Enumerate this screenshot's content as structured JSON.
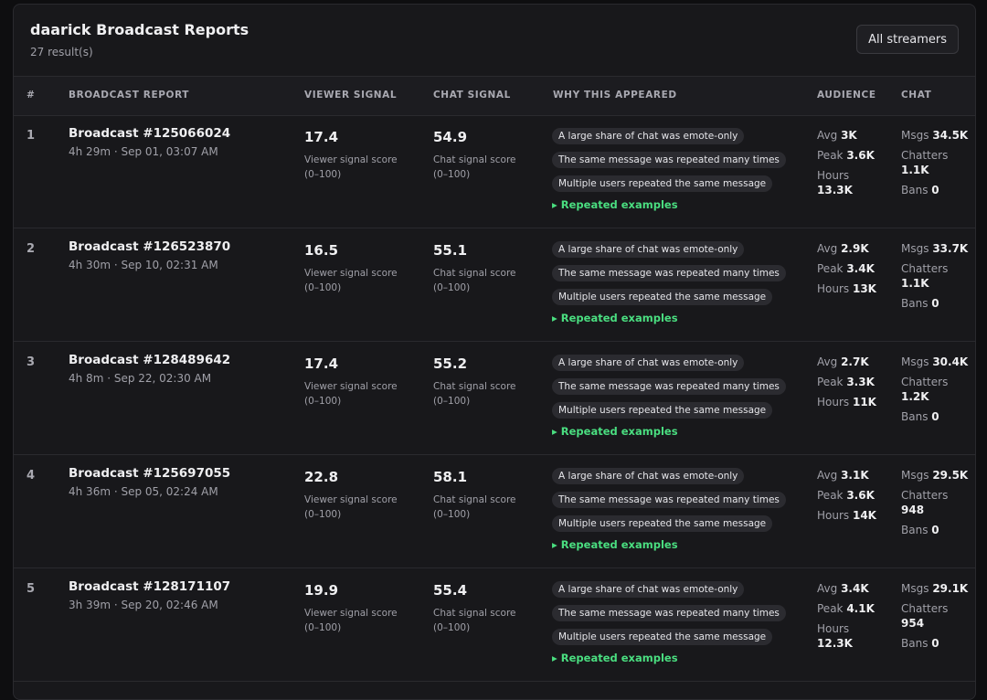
{
  "header": {
    "title": "daarick Broadcast Reports",
    "result_count": "27 result(s)",
    "all_streamers_label": "All streamers"
  },
  "columns": {
    "rank": "#",
    "report": "BROADCAST REPORT",
    "viewer": "VIEWER SIGNAL",
    "chat": "CHAT SIGNAL",
    "why": "WHY THIS APPEARED",
    "audience": "AUDIENCE",
    "chat_stats": "CHAT"
  },
  "labels": {
    "viewer_score": "Viewer signal score",
    "chat_score": "Chat signal score",
    "range": "(0–100)",
    "avg": "Avg",
    "peak": "Peak",
    "hours": "Hours",
    "msgs": "Msgs",
    "chatters": "Chatters",
    "bans": "Bans",
    "repeated": "▸ Repeated examples"
  },
  "rows": [
    {
      "rank": "1",
      "name": "Broadcast #125066024",
      "meta": "4h 29m · Sep 01, 03:07 AM",
      "viewer": "17.4",
      "chat": "54.9",
      "reasons": [
        "A large share of chat was emote-only",
        "The same message was repeated many times",
        "Multiple users repeated the same message"
      ],
      "avg": "3K",
      "peak": "3.6K",
      "hours": "13.3K",
      "msgs": "34.5K",
      "chatters": "1.1K",
      "bans": "0"
    },
    {
      "rank": "2",
      "name": "Broadcast #126523870",
      "meta": "4h 30m · Sep 10, 02:31 AM",
      "viewer": "16.5",
      "chat": "55.1",
      "reasons": [
        "A large share of chat was emote-only",
        "The same message was repeated many times",
        "Multiple users repeated the same message"
      ],
      "avg": "2.9K",
      "peak": "3.4K",
      "hours": "13K",
      "msgs": "33.7K",
      "chatters": "1.1K",
      "bans": "0"
    },
    {
      "rank": "3",
      "name": "Broadcast #128489642",
      "meta": "4h 8m · Sep 22, 02:30 AM",
      "viewer": "17.4",
      "chat": "55.2",
      "reasons": [
        "A large share of chat was emote-only",
        "The same message was repeated many times",
        "Multiple users repeated the same message"
      ],
      "avg": "2.7K",
      "peak": "3.3K",
      "hours": "11K",
      "msgs": "30.4K",
      "chatters": "1.2K",
      "bans": "0"
    },
    {
      "rank": "4",
      "name": "Broadcast #125697055",
      "meta": "4h 36m · Sep 05, 02:24 AM",
      "viewer": "22.8",
      "chat": "58.1",
      "reasons": [
        "A large share of chat was emote-only",
        "The same message was repeated many times",
        "Multiple users repeated the same message"
      ],
      "avg": "3.1K",
      "peak": "3.6K",
      "hours": "14K",
      "msgs": "29.5K",
      "chatters": "948",
      "bans": "0"
    },
    {
      "rank": "5",
      "name": "Broadcast #128171107",
      "meta": "3h 39m · Sep 20, 02:46 AM",
      "viewer": "19.9",
      "chat": "55.4",
      "reasons": [
        "A large share of chat was emote-only",
        "The same message was repeated many times",
        "Multiple users repeated the same message"
      ],
      "avg": "3.4K",
      "peak": "4.1K",
      "hours": "12.3K",
      "msgs": "29.1K",
      "chatters": "954",
      "bans": "0"
    }
  ]
}
